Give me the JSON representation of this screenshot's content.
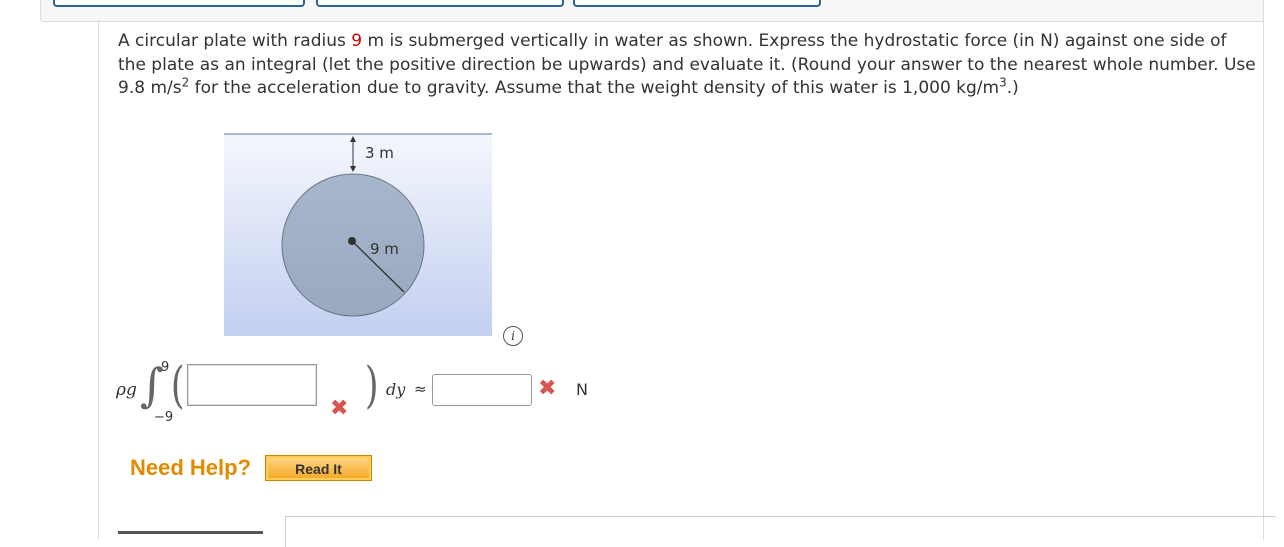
{
  "question": {
    "part1": "A circular plate with radius ",
    "radius": "9",
    "part2": " m is submerged vertically in water as shown. Express the hydrostatic force (in N) against one side of the plate as an integral (let the positive direction be upwards) and evaluate it. (Round your answer to the nearest whole number. Use 9.8 m/s",
    "sup1": "2",
    "part3": " for the acceleration due to gravity. Assume that the weight density of this water is 1,000 kg/m",
    "sup2": "3",
    "part4": ".)"
  },
  "figure": {
    "depth_label": "3 m",
    "radius_label": "9 m"
  },
  "info_icon": "i",
  "math": {
    "rho_g": "ρg",
    "integral_sign": "∫",
    "upper_limit": "9",
    "lower_limit": "−9",
    "integrand_value": "",
    "dy": "dy",
    "approx": "≈",
    "answer_value": "",
    "unit": "N",
    "mark": "✖"
  },
  "help": {
    "need_help": "Need Help?",
    "read_it": "Read It"
  },
  "colors": {
    "highlight_red": "#cc0000",
    "incorrect_red": "#d9534f",
    "help_orange": "#e28a00"
  }
}
